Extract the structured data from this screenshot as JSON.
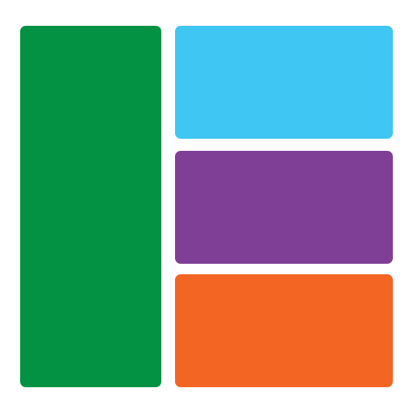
{
  "icon": "layout-grid-icon",
  "tiles": {
    "left": {
      "color": "#039243"
    },
    "top": {
      "color": "#3FC6F3"
    },
    "middle": {
      "color": "#7F3F97"
    },
    "bottom": {
      "color": "#F36523"
    }
  }
}
